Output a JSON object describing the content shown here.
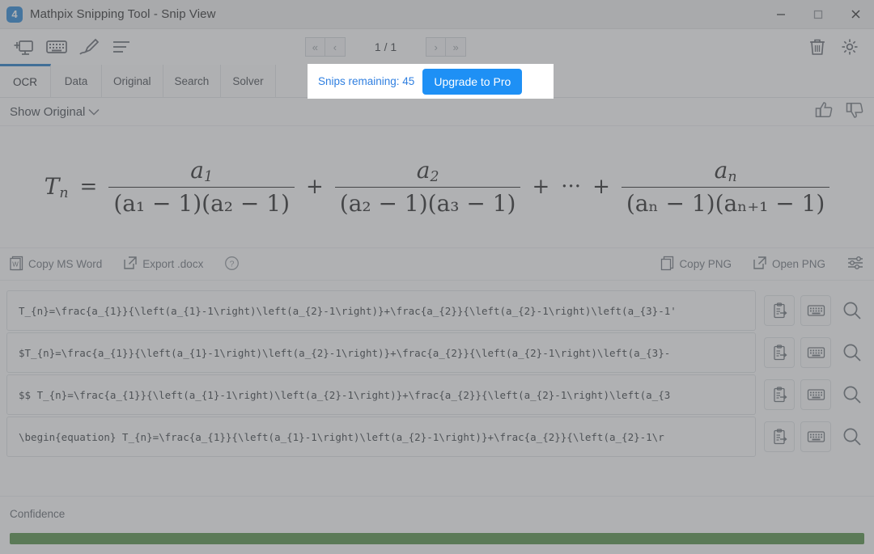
{
  "window": {
    "title": "Mathpix Snipping Tool - Snip View",
    "logo_glyph": "⬛",
    "logo_text": "4",
    "controls": [
      {
        "name": "minimize-button",
        "label": "—"
      },
      {
        "name": "maximize-button",
        "label": "□"
      },
      {
        "name": "close-button",
        "label": "✕"
      }
    ]
  },
  "toolbar": {
    "icons": [
      {
        "name": "new-snip-icon",
        "label": "new-snip-icon"
      },
      {
        "name": "keyboard-icon",
        "label": "keyboard-icon"
      },
      {
        "name": "draw-pen-icon",
        "label": "draw-pen-icon"
      },
      {
        "name": "text-lines-icon",
        "label": "text-lines-icon"
      }
    ],
    "pager": {
      "first": "«",
      "prev": "‹",
      "label": "1 / 1",
      "next": "›",
      "last": "»"
    },
    "right_icons": [
      {
        "name": "trash-icon",
        "label": "trash-icon"
      },
      {
        "name": "gear-icon",
        "label": "gear-icon"
      }
    ]
  },
  "tabs": [
    {
      "label": "OCR",
      "active": true
    },
    {
      "label": "Data",
      "active": false
    },
    {
      "label": "Original",
      "active": false
    },
    {
      "label": "Search",
      "active": false
    },
    {
      "label": "Solver",
      "active": false
    }
  ],
  "upgrade": {
    "snips_text": "Snips remaining: 45",
    "button_label": "Upgrade to Pro",
    "text_color": "#2f7fe0",
    "button_color": "#1e90f5"
  },
  "show_row": {
    "label": "Show Original",
    "chevron": "⌄",
    "thumbs_up": "thumbs-up-icon",
    "thumbs_down": "thumbs-down-icon"
  },
  "math": {
    "lhs": "T",
    "lhs_sub": "n",
    "equals": "=",
    "terms": [
      {
        "num_base": "a",
        "num_sub": "1",
        "den": "(a₁ − 1)(a₂ − 1)"
      },
      {
        "num_base": "a",
        "num_sub": "2",
        "den": "(a₂ − 1)(a₃ − 1)"
      },
      {
        "num_base": "a",
        "num_sub": "n",
        "den": "(aₙ − 1)(aₙ₊₁ − 1)"
      }
    ],
    "plus": "+",
    "dots": "···",
    "latex_source": "T_{n}=\\frac{a_{1}}{\\left(a_{1}-1\\right)\\left(a_{2}-1\\right)}+\\frac{a_{2}}{\\left(a_{2}-1\\right)\\left(a_{3}-1\\right)}+\\cdots+\\frac{a_{n}}{\\left(a_{n}-1\\right)\\left(a_{n+1}-1\\right)}"
  },
  "actions": {
    "left": [
      {
        "name": "copy-ms-word-button",
        "label": "Copy MS Word",
        "icon": "word-doc-icon"
      },
      {
        "name": "export-docx-button",
        "label": "Export .docx",
        "icon": "external-link-icon"
      },
      {
        "name": "help-button",
        "label": "",
        "icon": "help-circle-icon"
      }
    ],
    "right": [
      {
        "name": "copy-png-button",
        "label": "Copy PNG",
        "icon": "copy-icon"
      },
      {
        "name": "open-png-button",
        "label": "Open PNG",
        "icon": "external-link-icon"
      },
      {
        "name": "png-settings-button",
        "label": "",
        "icon": "sliders-icon"
      }
    ]
  },
  "results": {
    "rows": [
      {
        "code": "T_{n}=\\frac{a_{1}}{\\left(a_{1}-1\\right)\\left(a_{2}-1\\right)}+\\frac{a_{2}}{\\left(a_{2}-1\\right)\\left(a_{3}-1'"
      },
      {
        "code": "$T_{n}=\\frac{a_{1}}{\\left(a_{1}-1\\right)\\left(a_{2}-1\\right)}+\\frac{a_{2}}{\\left(a_{2}-1\\right)\\left(a_{3}-"
      },
      {
        "code": "$$  T_{n}=\\frac{a_{1}}{\\left(a_{1}-1\\right)\\left(a_{2}-1\\right)}+\\frac{a_{2}}{\\left(a_{2}-1\\right)\\left(a_{3"
      },
      {
        "code": "\\begin{equation}  T_{n}=\\frac{a_{1}}{\\left(a_{1}-1\\right)\\left(a_{2}-1\\right)}+\\frac{a_{2}}{\\left(a_{2}-1\\r"
      }
    ],
    "row_icons": [
      {
        "name": "copy-to-clipboard-icon",
        "label": "clipboard-paste-icon"
      },
      {
        "name": "keyboard-icon",
        "label": "keyboard-icon"
      },
      {
        "name": "search-icon",
        "label": "magnifier-icon"
      }
    ]
  },
  "confidence": {
    "label": "Confidence",
    "percent": 100,
    "color": "#4b8a3c"
  }
}
